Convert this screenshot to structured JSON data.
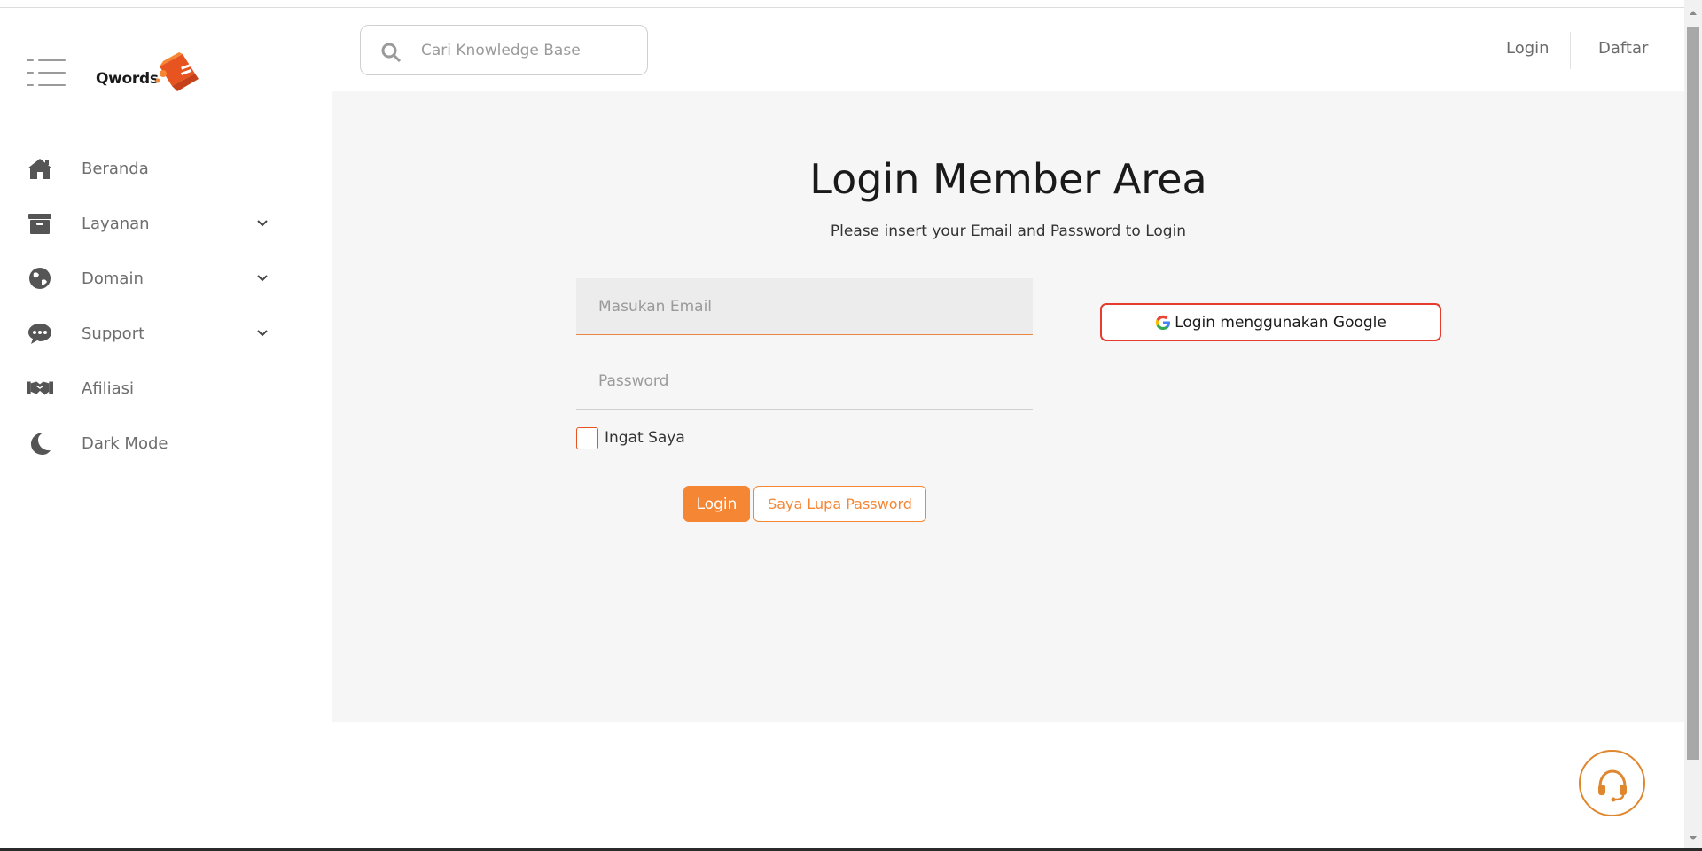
{
  "brand": {
    "name": "Qwords"
  },
  "sidebar": {
    "items": [
      {
        "label": "Beranda",
        "icon": "home-icon",
        "has_submenu": false
      },
      {
        "label": "Layanan",
        "icon": "archive-box-icon",
        "has_submenu": true
      },
      {
        "label": "Domain",
        "icon": "globe-icon",
        "has_submenu": true
      },
      {
        "label": "Support",
        "icon": "chat-bubble-icon",
        "has_submenu": true
      },
      {
        "label": "Afiliasi",
        "icon": "handshake-icon",
        "has_submenu": false
      },
      {
        "label": "Dark Mode",
        "icon": "moon-icon",
        "has_submenu": false
      }
    ]
  },
  "header": {
    "search_placeholder": "Cari Knowledge Base",
    "login_label": "Login",
    "register_label": "Daftar"
  },
  "login": {
    "title": "Login Member Area",
    "subtitle": "Please insert your Email and Password to Login",
    "email_placeholder": "Masukan Email",
    "password_placeholder": "Password",
    "remember_label": "Ingat Saya",
    "login_button": "Login",
    "forgot_button": "Saya Lupa Password",
    "google_button": "Login menggunakan Google"
  },
  "colors": {
    "accent": "#f58634",
    "google_border": "#e63b2e",
    "panel_bg": "#f6f6f6"
  }
}
